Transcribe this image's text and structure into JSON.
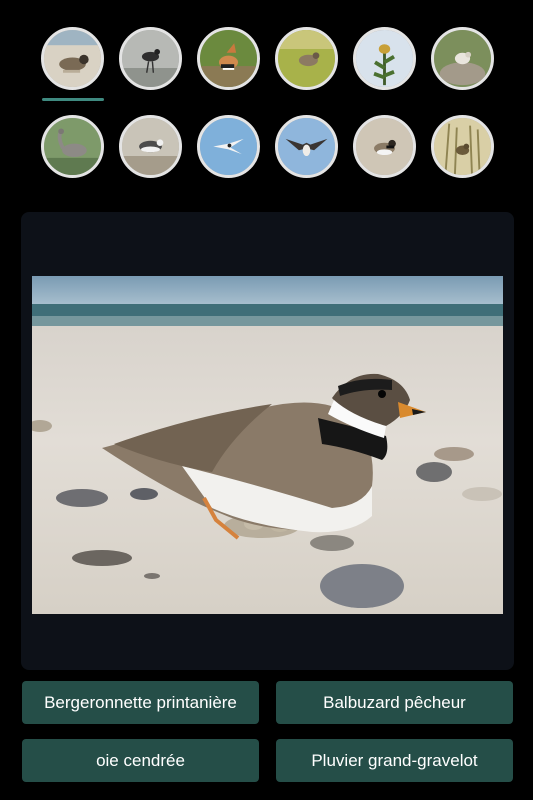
{
  "thumbnails_row1": [
    {
      "icon": "plover-on-sand-icon",
      "selected": true
    },
    {
      "icon": "wader-bird-icon",
      "selected": false
    },
    {
      "icon": "hoopoe-icon",
      "selected": false
    },
    {
      "icon": "bird-in-grass-icon",
      "selected": false
    },
    {
      "icon": "bird-on-plant-icon",
      "selected": false
    },
    {
      "icon": "bird-on-rock-icon",
      "selected": false
    }
  ],
  "thumbnails_row2": [
    {
      "icon": "goose-icon",
      "selected": false
    },
    {
      "icon": "gull-icon",
      "selected": false
    },
    {
      "icon": "tern-flying-icon",
      "selected": false
    },
    {
      "icon": "osprey-flying-icon",
      "selected": false
    },
    {
      "icon": "ringed-plover-icon",
      "selected": false
    },
    {
      "icon": "bird-in-reeds-icon",
      "selected": false
    }
  ],
  "colors": {
    "background": "#000000",
    "card": "#0d1118",
    "button": "#254e48",
    "indicator": "#3f8a80",
    "button_text": "#ffffff"
  },
  "answers": [
    {
      "label": "Bergeronnette printanière"
    },
    {
      "label": "Balbuzard pêcheur"
    },
    {
      "label": "oie cendrée"
    },
    {
      "label": "Pluvier grand-gravelot"
    }
  ]
}
